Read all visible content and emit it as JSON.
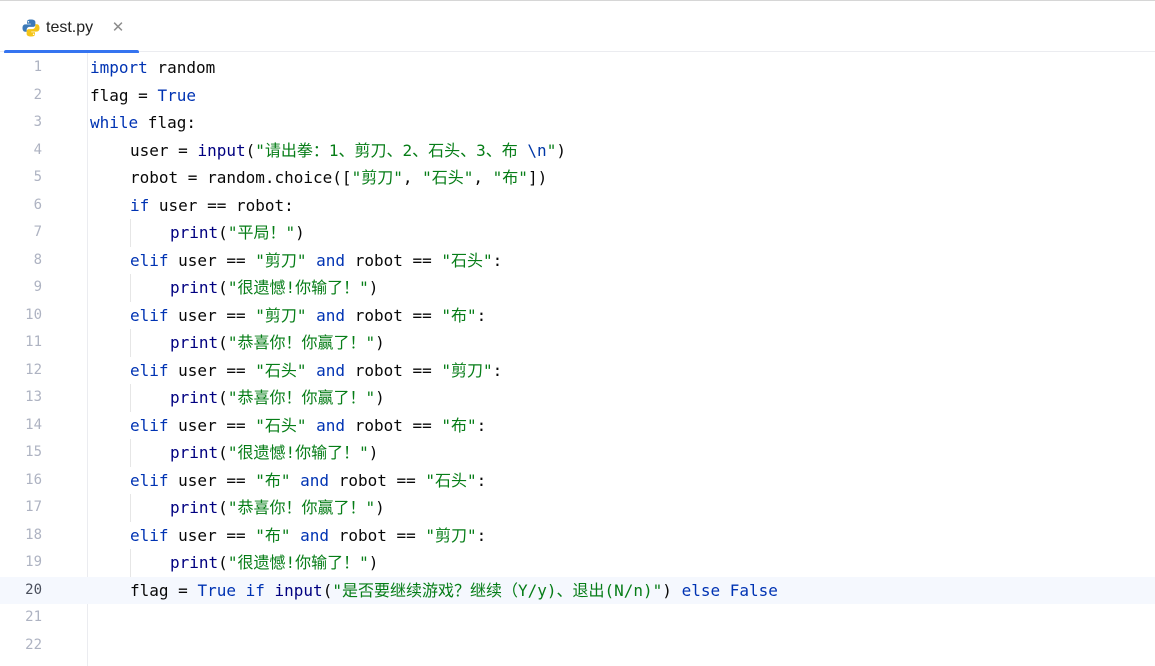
{
  "tab": {
    "filename": "test.py",
    "close_glyph": "✕",
    "icon": "python-file-icon",
    "active": true
  },
  "colors": {
    "keyword": "#0033b3",
    "string": "#067d17",
    "builtin": "#000080",
    "accent": "#3574f0",
    "current_line": "#f5f8fe"
  },
  "editor": {
    "current_line": 20,
    "lines": [
      {
        "n": "1",
        "indent": 0,
        "tokens": [
          {
            "t": "kw",
            "v": "import"
          },
          {
            "t": "p",
            "v": " random"
          }
        ]
      },
      {
        "n": "2",
        "indent": 0,
        "tokens": [
          {
            "t": "p",
            "v": "flag = "
          },
          {
            "t": "kw",
            "v": "True"
          }
        ]
      },
      {
        "n": "3",
        "indent": 0,
        "tokens": [
          {
            "t": "kw",
            "v": "while"
          },
          {
            "t": "p",
            "v": " flag:"
          }
        ]
      },
      {
        "n": "4",
        "indent": 1,
        "tokens": [
          {
            "t": "p",
            "v": "user = "
          },
          {
            "t": "fn",
            "v": "input"
          },
          {
            "t": "p",
            "v": "("
          },
          {
            "t": "str",
            "v": "\"请出拳：1、剪刀、2、石头、3、布 "
          },
          {
            "t": "esc",
            "v": "\\n"
          },
          {
            "t": "str",
            "v": "\""
          },
          {
            "t": "p",
            "v": ")"
          }
        ]
      },
      {
        "n": "5",
        "indent": 1,
        "tokens": [
          {
            "t": "p",
            "v": "robot = random.choice(["
          },
          {
            "t": "str",
            "v": "\"剪刀\""
          },
          {
            "t": "p",
            "v": ", "
          },
          {
            "t": "str",
            "v": "\"石头\""
          },
          {
            "t": "p",
            "v": ", "
          },
          {
            "t": "str",
            "v": "\"布\""
          },
          {
            "t": "p",
            "v": "])"
          }
        ]
      },
      {
        "n": "6",
        "indent": 1,
        "tokens": [
          {
            "t": "kw",
            "v": "if"
          },
          {
            "t": "p",
            "v": " user == robot:"
          }
        ]
      },
      {
        "n": "7",
        "indent": 2,
        "tokens": [
          {
            "t": "fn",
            "v": "print"
          },
          {
            "t": "p",
            "v": "("
          },
          {
            "t": "str",
            "v": "\"平局！\""
          },
          {
            "t": "p",
            "v": ")"
          }
        ]
      },
      {
        "n": "8",
        "indent": 1,
        "tokens": [
          {
            "t": "kw",
            "v": "elif"
          },
          {
            "t": "p",
            "v": " user == "
          },
          {
            "t": "str",
            "v": "\"剪刀\""
          },
          {
            "t": "p",
            "v": " "
          },
          {
            "t": "kw",
            "v": "and"
          },
          {
            "t": "p",
            "v": " robot == "
          },
          {
            "t": "str",
            "v": "\"石头\""
          },
          {
            "t": "p",
            "v": ":"
          }
        ]
      },
      {
        "n": "9",
        "indent": 2,
        "tokens": [
          {
            "t": "fn",
            "v": "print"
          },
          {
            "t": "p",
            "v": "("
          },
          {
            "t": "str",
            "v": "\"很遗憾!你输了！\""
          },
          {
            "t": "p",
            "v": ")"
          }
        ]
      },
      {
        "n": "10",
        "indent": 1,
        "tokens": [
          {
            "t": "kw",
            "v": "elif"
          },
          {
            "t": "p",
            "v": " user == "
          },
          {
            "t": "str",
            "v": "\"剪刀\""
          },
          {
            "t": "p",
            "v": " "
          },
          {
            "t": "kw",
            "v": "and"
          },
          {
            "t": "p",
            "v": " robot == "
          },
          {
            "t": "str",
            "v": "\"布\""
          },
          {
            "t": "p",
            "v": ":"
          }
        ]
      },
      {
        "n": "11",
        "indent": 2,
        "tokens": [
          {
            "t": "fn",
            "v": "print"
          },
          {
            "t": "p",
            "v": "("
          },
          {
            "t": "str",
            "v": "\"恭喜你！你赢了！\""
          },
          {
            "t": "p",
            "v": ")"
          }
        ]
      },
      {
        "n": "12",
        "indent": 1,
        "tokens": [
          {
            "t": "kw",
            "v": "elif"
          },
          {
            "t": "p",
            "v": " user == "
          },
          {
            "t": "str",
            "v": "\"石头\""
          },
          {
            "t": "p",
            "v": " "
          },
          {
            "t": "kw",
            "v": "and"
          },
          {
            "t": "p",
            "v": " robot == "
          },
          {
            "t": "str",
            "v": "\"剪刀\""
          },
          {
            "t": "p",
            "v": ":"
          }
        ]
      },
      {
        "n": "13",
        "indent": 2,
        "tokens": [
          {
            "t": "fn",
            "v": "print"
          },
          {
            "t": "p",
            "v": "("
          },
          {
            "t": "str",
            "v": "\"恭喜你！你赢了！\""
          },
          {
            "t": "p",
            "v": ")"
          }
        ]
      },
      {
        "n": "14",
        "indent": 1,
        "tokens": [
          {
            "t": "kw",
            "v": "elif"
          },
          {
            "t": "p",
            "v": " user == "
          },
          {
            "t": "str",
            "v": "\"石头\""
          },
          {
            "t": "p",
            "v": " "
          },
          {
            "t": "kw",
            "v": "and"
          },
          {
            "t": "p",
            "v": " robot == "
          },
          {
            "t": "str",
            "v": "\"布\""
          },
          {
            "t": "p",
            "v": ":"
          }
        ]
      },
      {
        "n": "15",
        "indent": 2,
        "tokens": [
          {
            "t": "fn",
            "v": "print"
          },
          {
            "t": "p",
            "v": "("
          },
          {
            "t": "str",
            "v": "\"很遗憾!你输了！\""
          },
          {
            "t": "p",
            "v": ")"
          }
        ]
      },
      {
        "n": "16",
        "indent": 1,
        "tokens": [
          {
            "t": "kw",
            "v": "elif"
          },
          {
            "t": "p",
            "v": " user == "
          },
          {
            "t": "str",
            "v": "\"布\""
          },
          {
            "t": "p",
            "v": " "
          },
          {
            "t": "kw",
            "v": "and"
          },
          {
            "t": "p",
            "v": " robot == "
          },
          {
            "t": "str",
            "v": "\"石头\""
          },
          {
            "t": "p",
            "v": ":"
          }
        ]
      },
      {
        "n": "17",
        "indent": 2,
        "tokens": [
          {
            "t": "fn",
            "v": "print"
          },
          {
            "t": "p",
            "v": "("
          },
          {
            "t": "str",
            "v": "\"恭喜你！你赢了！\""
          },
          {
            "t": "p",
            "v": ")"
          }
        ]
      },
      {
        "n": "18",
        "indent": 1,
        "tokens": [
          {
            "t": "kw",
            "v": "elif"
          },
          {
            "t": "p",
            "v": " user == "
          },
          {
            "t": "str",
            "v": "\"布\""
          },
          {
            "t": "p",
            "v": " "
          },
          {
            "t": "kw",
            "v": "and"
          },
          {
            "t": "p",
            "v": " robot == "
          },
          {
            "t": "str",
            "v": "\"剪刀\""
          },
          {
            "t": "p",
            "v": ":"
          }
        ]
      },
      {
        "n": "19",
        "indent": 2,
        "tokens": [
          {
            "t": "fn",
            "v": "print"
          },
          {
            "t": "p",
            "v": "("
          },
          {
            "t": "str",
            "v": "\"很遗憾!你输了！\""
          },
          {
            "t": "p",
            "v": ")"
          }
        ]
      },
      {
        "n": "20",
        "indent": 1,
        "tokens": [
          {
            "t": "p",
            "v": "flag = "
          },
          {
            "t": "kw",
            "v": "True"
          },
          {
            "t": "p",
            "v": " "
          },
          {
            "t": "kw",
            "v": "if"
          },
          {
            "t": "p",
            "v": " "
          },
          {
            "t": "fn",
            "v": "input"
          },
          {
            "t": "p",
            "v": "("
          },
          {
            "t": "str",
            "v": "\"是否要继续游戏？继续（Y/y)、退出(N/n)\""
          },
          {
            "t": "p",
            "v": ") "
          },
          {
            "t": "kw",
            "v": "else"
          },
          {
            "t": "p",
            "v": " "
          },
          {
            "t": "kw",
            "v": "False"
          }
        ]
      },
      {
        "n": "21",
        "indent": 0,
        "tokens": []
      },
      {
        "n": "22",
        "indent": 0,
        "tokens": []
      }
    ]
  }
}
